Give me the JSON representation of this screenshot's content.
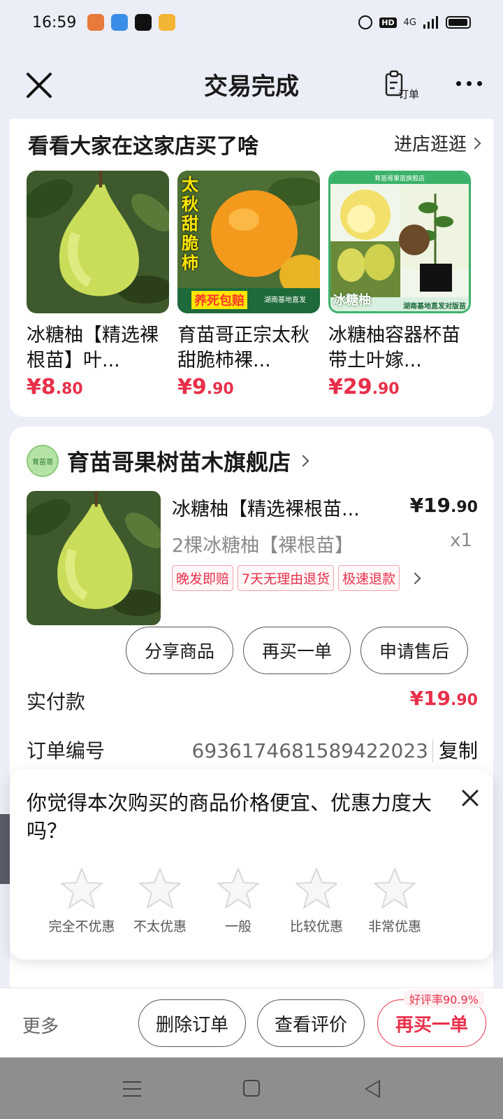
{
  "status_bar": {
    "time": "16:59",
    "network": "4G",
    "hd": "HD",
    "app_colors": [
      "#e87a3c",
      "#3a8ee8",
      "#111111",
      "#f2b534"
    ]
  },
  "nav": {
    "title": "交易完成",
    "order_label": "订单",
    "icons": [
      "close-icon",
      "order-icon",
      "more-icon"
    ]
  },
  "recommend": {
    "title": "看看大家在这家店买了啥",
    "link": "进店逛逛",
    "items": [
      {
        "name": "冰糖柚【精选裸根苗】叶...",
        "price_main": "¥8",
        "price_dec": ".80",
        "image": "pomelo"
      },
      {
        "name": "育苗哥正宗太秋甜脆柿裸...",
        "price_main": "¥9",
        "price_dec": ".90",
        "image": "persimmon",
        "overlay": [
          "太",
          "秋",
          "甜",
          "脆",
          "柿"
        ],
        "banner": "养死包赔",
        "banner_sub": "湖南基地直发"
      },
      {
        "name": "冰糖柚容器杯苗带土叶嫁...",
        "price_main": "¥29",
        "price_dec": ".90",
        "image": "pomelo-seedling",
        "overlay_top": "育苗哥果苗旗舰店",
        "overlay_label": "冰糖柚",
        "overlay_bottom": "湖南基地直发对版苗"
      }
    ]
  },
  "order": {
    "shop_name": "育苗哥果树苗木旗舰店",
    "shop_logo_text": "育苗哥",
    "product": {
      "title": "冰糖柚【精选裸根苗...",
      "price_main": "¥19",
      "price_dec": ".90",
      "sku": "2棵冰糖柚【裸根苗】",
      "qty": "x1",
      "tags": [
        "晚发即赔",
        "7天无理由退货",
        "极速退款"
      ]
    },
    "buttons": [
      "分享商品",
      "再买一单",
      "申请售后"
    ],
    "paid_label": "实付款",
    "paid_main": "¥19",
    "paid_dec": ".90",
    "order_no_label": "订单编号",
    "order_no": "6936174681589422023",
    "copy_label": "复制"
  },
  "survey": {
    "question": "你觉得本次购买的商品价格便宜、优惠力度大吗？",
    "options": [
      "完全不优惠",
      "不太优惠",
      "一般",
      "比较优惠",
      "非常优惠"
    ]
  },
  "action_bar": {
    "more": "更多",
    "delete": "删除订单",
    "view_review": "查看评价",
    "rebuy": "再买一单",
    "rating_badge": "好评率90.9%"
  },
  "colors": {
    "accent": "#e8304a",
    "background": "#eceef7"
  }
}
